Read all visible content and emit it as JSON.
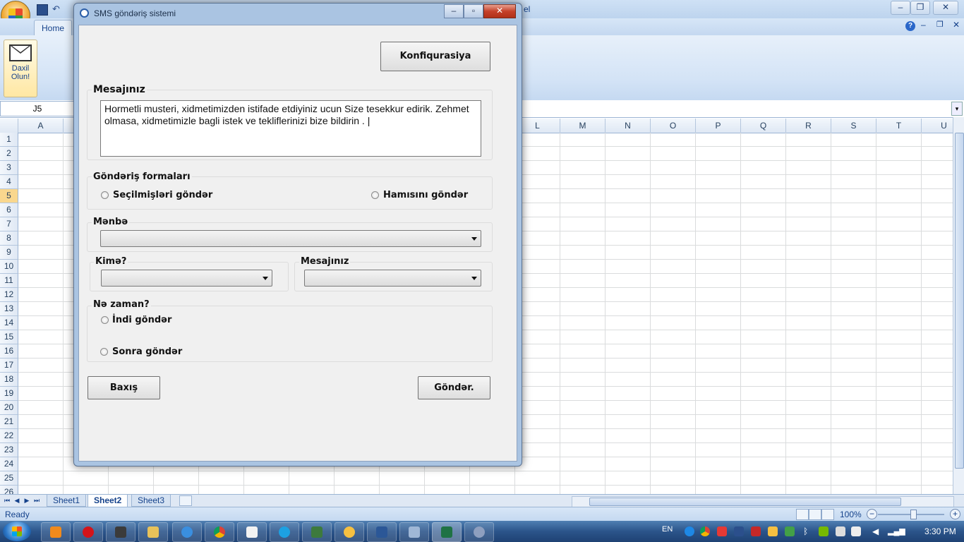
{
  "excel": {
    "title_fragment": "el",
    "ribbon_tab": "Home",
    "daxil_button": "Daxil Olun!",
    "namebox": "J5",
    "columns": [
      "A",
      "",
      "",
      "",
      "",
      "",
      "",
      "",
      "",
      "",
      "",
      "L",
      "M",
      "N",
      "O",
      "P",
      "Q",
      "R",
      "S",
      "T",
      "U"
    ],
    "rows": [
      "1",
      "2",
      "3",
      "4",
      "5",
      "6",
      "7",
      "8",
      "9",
      "10",
      "11",
      "12",
      "13",
      "14",
      "15",
      "16",
      "17",
      "18",
      "19",
      "20",
      "21",
      "22",
      "23",
      "24",
      "25",
      "26"
    ],
    "selected_row": "5",
    "sheets": [
      "Sheet1",
      "Sheet2",
      "Sheet3"
    ],
    "active_sheet": "Sheet2",
    "status": "Ready",
    "zoom": "100%"
  },
  "taskbar": {
    "language": "EN",
    "clock": "3:30 PM"
  },
  "dialog": {
    "title": "SMS göndəriş sistemi",
    "config_button": "Konfiqurasiya",
    "message_group_label": "Mesajınız",
    "message_text": "Hormetli musteri, xidmetimizden istifade etdiyiniz ucun Size tesekkur edirik. Zehmet olmasa, xidmetimizle bagli istek ve tekliflerinizi bize bildirin . |",
    "send_forms_label": "Göndəriş formaları",
    "send_selected": "Seçilmişləri göndər",
    "send_all": "Hamısını göndər",
    "source_label": "Mənbə",
    "to_label": "Kimə?",
    "message_label2": "Mesajınız",
    "when_label": "Nə zaman?",
    "send_now": "İndi göndər",
    "send_later": "Sonra göndər",
    "preview_button": "Baxış",
    "send_button": "Göndər."
  }
}
